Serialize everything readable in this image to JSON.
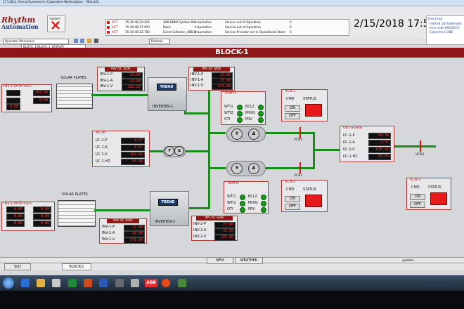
{
  "titlebar": {
    "text": "171.88.1 Arena/Systems/xr Cyberdine-Workstation - [Block1]"
  },
  "logo": {
    "top": "Rhythm",
    "bottom": "Automation"
  },
  "system_label": "System",
  "alarms": [
    {
      "kind": "ACT",
      "time": "15:16:48:23:416",
      "source": "ABB BBNA System Mo",
      "state": "Inoperative",
      "message": "Service out of Operation",
      "count": "0"
    },
    {
      "kind": "ACT",
      "time": "15:16:48:17:910",
      "source": "Basic",
      "state": "Inoperative",
      "message": "Service out of Operation",
      "count": "0"
    },
    {
      "kind": "ACT",
      "time": "15:16:48:12:700",
      "source": "Event Collector_ABB B",
      "state": "Inoperative",
      "message": "Service Provider not in Operational State",
      "count": "0"
    }
  ],
  "datetime": "2/15/2018 17:53",
  "notes": {
    "title": "Event Log",
    "line1": "method call failed with",
    "line2": "error code 0XE2D017",
    "line3": "Cyberinto C-ABB"
  },
  "toolbar": {
    "workplace": "Operator Workplace",
    "path": "BLOCK_1\\BLOCK_1_DISPLAY",
    "filter": "Boolean"
  },
  "block_title": "BLOCK-1",
  "inv1_mfm": {
    "title": "INV-1 MFM VOLT",
    "v1": "303.84",
    "v2": "0.00",
    "v3": "0.00"
  },
  "inv2_mfm": {
    "title": "INV-1 MFM VOLT",
    "v1": "0.00",
    "v2": "0.00",
    "v3": "0.00",
    "v4": "0.00",
    "v5": "0.00",
    "v6": "0.00"
  },
  "solar1": "SOLAR PLATES",
  "solar2": "SOLAR PLATES",
  "inv1_dc": {
    "title": "INV DC SIDE",
    "l1": "INV-1-P",
    "l2": "INV-1-A",
    "l3": "INV-1-V",
    "v1": "24.80",
    "v2": "42.80",
    "v3": "582.80"
  },
  "inv1_ac": {
    "title": "INV AC SIDE",
    "l1": "INV-1-P",
    "l2": "INV-1-A",
    "l3": "INV-1-V",
    "v1": "23.00",
    "v2": "37.00",
    "v3": "374.00"
  },
  "inv2_dc": {
    "title": "INV DC SIDE",
    "l1": "INV-1-P",
    "l2": "INV-1-A",
    "l3": "INV-1-V",
    "v1": "23.00",
    "v2": "41.00",
    "v3": "579.00"
  },
  "inv2_ac": {
    "title": "INV AC SIDE",
    "l1": "INV-2-P",
    "l2": "INV-2-A",
    "l3": "INV-2-V",
    "v1": "23.00",
    "v2": "35.00",
    "v3": "375.00"
  },
  "inverter1": {
    "trend": "TREND",
    "label": "INVERTER-1"
  },
  "inverter2": {
    "trend": "TREND",
    "label": "INVERTER-2"
  },
  "acdb": {
    "title": "ACDB",
    "l1": "I/C-1-P",
    "l2": "I/C-1-A",
    "l3": "I/C-1-V",
    "l4": "I/C-1-HZ",
    "v1": "4.57",
    "v2": "3.57",
    "v3": "163.82",
    "v4": "50.00"
  },
  "trafo1": {
    "title": "TRAFO",
    "a": "WTI1",
    "b": "WTI2",
    "c": "OTI",
    "d": "BCLZ",
    "e": "PRXG",
    "f": "PRV"
  },
  "trafo2": {
    "title": "TRAFO",
    "a": "WTI1",
    "b": "WTI2",
    "c": "OTI",
    "d": "BCLZ",
    "e": "PRXG",
    "f": "PRV"
  },
  "vcb1": {
    "title": "VCB-1",
    "cmd": "CMD",
    "status": "STATUS",
    "on": "ON",
    "off": "OFF",
    "label": "VCB1"
  },
  "vcb2": {
    "title": "VCB-2",
    "cmd": "CMD",
    "status": "STATUS",
    "on": "ON",
    "off": "OFF",
    "label": "VCB2"
  },
  "vcb3": {
    "title": "VCB-3",
    "cmd": "CMD",
    "status": "STATUS",
    "on": "ON",
    "off": "OFF",
    "label": "VCB3"
  },
  "outgoing": {
    "title": "OUTGOING",
    "l1": "I/C-1-P",
    "l2": "I/C-1-A",
    "l3": "I/C-1-V",
    "l4": "I/C-1-HZ",
    "v1": "44.38",
    "v2": "2.37",
    "v3": "630.16",
    "v4": "50.05"
  },
  "tabs": {
    "sld": "SLD",
    "block1": "BLOCK-1",
    "mfm": "MFM",
    "weather": "WEATHER"
  },
  "statusbar": {
    "right": "system"
  },
  "tray": {
    "lang": "ABB"
  },
  "colors": {
    "panel_border": "#b33a3a",
    "header": "#8f1616",
    "bus": "#1a8a1a",
    "value_text": "#ff3b3b",
    "status_red": "#e61c1c"
  }
}
